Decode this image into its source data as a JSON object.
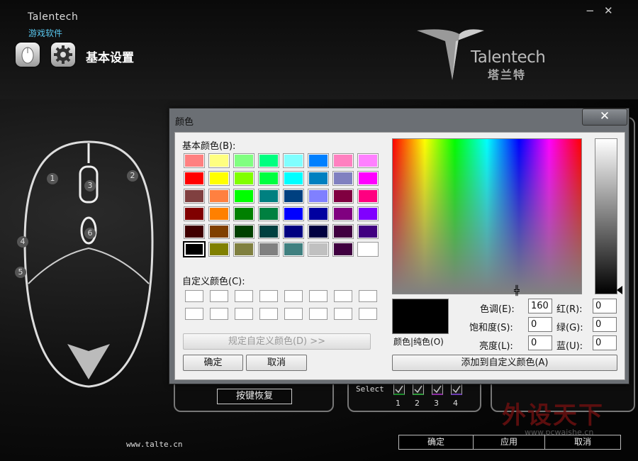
{
  "app": {
    "brand": "Talentech",
    "brand_sub": "游戏软件",
    "title": "基本设置",
    "logo_name": "Talentech",
    "logo_cn": "塔兰特",
    "minimize": "−",
    "close": "✕"
  },
  "mouse": {
    "buttons": [
      "1",
      "2",
      "3",
      "4",
      "5",
      "6"
    ]
  },
  "key_restore": "按键恢复",
  "select": {
    "label": "Select",
    "items": [
      "1",
      "2",
      "3",
      "4"
    ],
    "colors": [
      "#1a8a2a",
      "#2f9a3a",
      "#8a2aa0",
      "#6a3ab0"
    ]
  },
  "footer": {
    "url": "www.talte.cn",
    "ok": "确定",
    "apply": "应用",
    "cancel": "取消"
  },
  "watermark": {
    "text": "外设天下",
    "sub": "www.pcwaishe.cn"
  },
  "dialog": {
    "title": "颜色",
    "close": "✕",
    "basic_label": "基本颜色(B):",
    "custom_label": "自定义颜色(C):",
    "define_custom": "规定自定义颜色(D) >>",
    "ok": "确定",
    "cancel": "取消",
    "add_custom": "添加到自定义颜色(A)",
    "preview_label": "颜色|纯色(O)",
    "hue_label": "色调(E):",
    "hue": "160",
    "sat_label": "饱和度(S):",
    "sat": "0",
    "lum_label": "亮度(L):",
    "lum": "0",
    "red_label": "红(R):",
    "red": "0",
    "green_label": "绿(G):",
    "green": "0",
    "blue_label": "蓝(U):",
    "blue": "0",
    "basic_colors": [
      "#ff8080",
      "#ffff80",
      "#80ff80",
      "#00ff80",
      "#80ffff",
      "#0080ff",
      "#ff80c0",
      "#ff80ff",
      "#ff0000",
      "#ffff00",
      "#80ff00",
      "#00ff40",
      "#00ffff",
      "#0080c0",
      "#8080c0",
      "#ff00ff",
      "#804040",
      "#ff8040",
      "#00ff00",
      "#008080",
      "#004080",
      "#8080ff",
      "#800040",
      "#ff0080",
      "#800000",
      "#ff8000",
      "#008000",
      "#008040",
      "#0000ff",
      "#0000a0",
      "#800080",
      "#8000ff",
      "#400000",
      "#804000",
      "#004000",
      "#004040",
      "#000080",
      "#000040",
      "#400040",
      "#400080",
      "#000000",
      "#808000",
      "#808040",
      "#808080",
      "#408080",
      "#c0c0c0",
      "#400040",
      "#ffffff"
    ],
    "selected_index": 40
  }
}
